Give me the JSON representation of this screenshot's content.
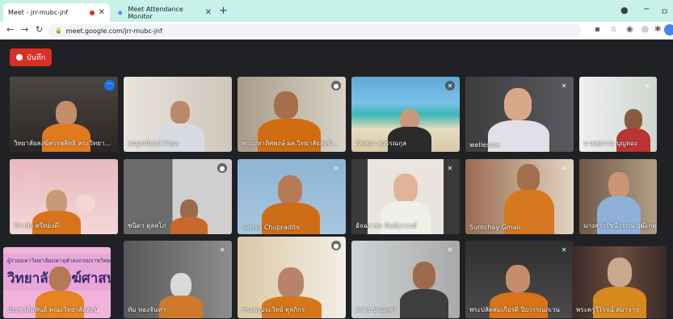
{
  "browser": {
    "tabs": [
      {
        "title": "Meet - jrr-mubc-jnf",
        "active": true,
        "recording": true
      },
      {
        "title": "Meet Attendance Monitor",
        "active": false,
        "recording": false
      }
    ],
    "new_tab": "+",
    "window_controls": {
      "minimize": "−",
      "maximize": "ㅁ"
    },
    "url": "meet.google.com/jrr-mubc-jnf"
  },
  "meet": {
    "record_label": "บันทึก",
    "participants": [
      {
        "name": "วิทยาลัยสงฆ์สรรพสิทธิ พระวิทยาลัย...",
        "muted": false,
        "highlighted": true
      },
      {
        "name": "สมบูรณ์พงษ์ ตัวยภ",
        "muted": false,
        "highlighted": false
      },
      {
        "name": "พระมหาทิศพงษ์ ผล.วิทยาลัยสงฆ์...",
        "muted": false,
        "highlighted": false
      },
      {
        "name": "ภัชลดา สุวรรณกุล",
        "muted": true,
        "highlighted": false
      },
      {
        "name": "wellesoer",
        "muted": true,
        "highlighted": false
      },
      {
        "name": "นายสุธรรม บุญทอง",
        "muted": true,
        "highlighted": false
      },
      {
        "name": "ฟ้าวลัย ศรีทองดี",
        "muted": false,
        "highlighted": false
      },
      {
        "name": "ชนิดา ดุลลโภ",
        "muted": false,
        "highlighted": false
      },
      {
        "name": "Suriya Chupradits",
        "muted": true,
        "highlighted": false
      },
      {
        "name": "อัจฉราพร ทิพย์สุวรรณ์",
        "muted": true,
        "highlighted": false
      },
      {
        "name": "Sumchay Gmail",
        "muted": true,
        "highlighted": false
      },
      {
        "name": "นางสาวรัชนีวรรณ วุฒิเกตุ วิทยา",
        "muted": false,
        "highlighted": false
      },
      {
        "name": "ประชาสัมพันธ์ คณะวิทยาลัยสงฆ์",
        "muted": false,
        "highlighted": false,
        "banner_l1": "ผู้ร่วมมหาวิทยาลัยมหาจุฬาลงกรณราชวิทยาลัย",
        "banner_l2": "วิทยาลัยสงฆ์ศาสนศึกษา"
      },
      {
        "name": "ทัม ทองจันทา",
        "muted": true,
        "highlighted": false
      },
      {
        "name": "พระครูประวิทย์ ตุลกิกร",
        "muted": false,
        "highlighted": false
      },
      {
        "name": "สาคร ปานจุลา",
        "muted": true,
        "highlighted": false
      },
      {
        "name": "พระปลัดสมเกียรติ ปิยวรรณภเวน",
        "muted": true,
        "highlighted": false
      },
      {
        "name": "พระครูวิโรจน์ สมาจาร",
        "muted": false,
        "highlighted": false
      }
    ]
  }
}
